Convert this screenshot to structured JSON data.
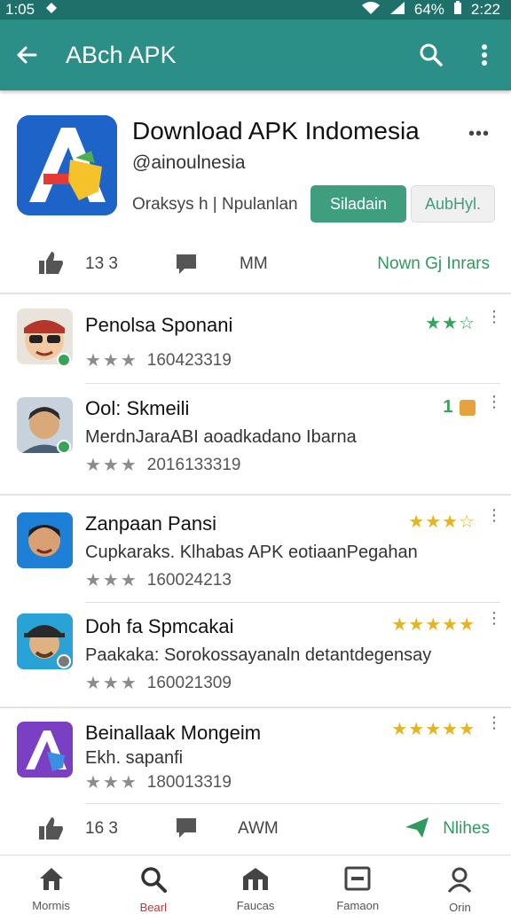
{
  "status_bar": {
    "time": "1:05",
    "battery": "64%",
    "clock": "2:22"
  },
  "app_bar": {
    "title": "AΒch APK"
  },
  "app": {
    "name": "Download APK Indomesia",
    "developer": "@ainoulnesia",
    "meta": "Oraksys h |  Npulanlan",
    "primary_button": "Siladain",
    "secondary_button": "AubHyl.",
    "likes": "13 3",
    "comments": "MM",
    "link": "Nown Gj Inrars"
  },
  "reviews": [
    {
      "name": "Penolsa Sponani",
      "text": "",
      "meta": "160423319",
      "stars": "★★☆"
    },
    {
      "name": "Ool: Skmeili",
      "text": "MerdnJaraABI aoadkadano Ibarna",
      "meta": "2016133319",
      "stars": "1"
    },
    {
      "name": "Zanpaan Pansi",
      "text": "Cupkaraks. Klhabas APK eotiaanPegahan",
      "meta": "160024213",
      "stars": "★★★☆"
    },
    {
      "name": "Doh fa Spmcakai",
      "text": "Paakaka: Sorokossayanaln detantdegensay",
      "meta": "160021309",
      "stars": "★★★★★"
    },
    {
      "name": "Beinallaak Mongeim",
      "text": "Ekh. sapanfi",
      "meta": "180013319",
      "stars": "★★★★★"
    }
  ],
  "footer_stats": {
    "likes": "16 3",
    "comments": "AWM",
    "action": "Nlihes"
  },
  "bottom_nav": [
    {
      "label": "Mormis"
    },
    {
      "label": "Bearl"
    },
    {
      "label": "Faucas"
    },
    {
      "label": "Famaon"
    },
    {
      "label": "Orin"
    }
  ],
  "colors": {
    "app_bar": "#2b8e87",
    "status_bar": "#1f6f6a",
    "accent_green": "#3e9e7d",
    "star_gold": "#e6b422",
    "star_green": "#3aa35b"
  }
}
